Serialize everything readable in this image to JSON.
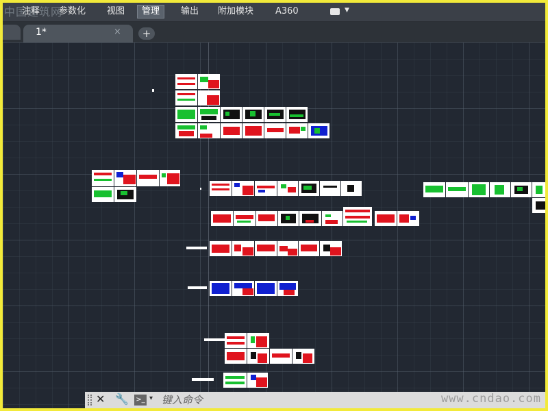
{
  "watermark_top": "中国建筑网",
  "menu": {
    "items": [
      "注释",
      "参数化",
      "视图",
      "管理",
      "输出",
      "附加模块",
      "A360"
    ],
    "active": "管理"
  },
  "tabs": {
    "document_label": "1*",
    "add_label": "+",
    "close_glyph": "×"
  },
  "command_line": {
    "placeholder": "键入命令",
    "close_glyph": "✕",
    "wrench_glyph": "🔧",
    "prompt_glyph": ">_",
    "dropdown_glyph": "▾"
  },
  "watermark_bottom": "www.cndao.com",
  "colors": {
    "canvas": "#222832",
    "sheet_red": "#e0141e",
    "sheet_green": "#18c030",
    "sheet_blue": "#1020d0",
    "border_yellow": "#f2ea3a"
  }
}
